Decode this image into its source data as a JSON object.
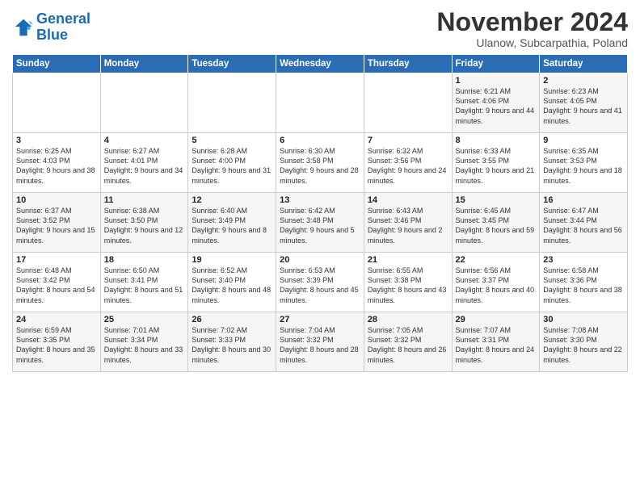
{
  "header": {
    "logo_line1": "General",
    "logo_line2": "Blue",
    "month": "November 2024",
    "location": "Ulanow, Subcarpathia, Poland"
  },
  "days_of_week": [
    "Sunday",
    "Monday",
    "Tuesday",
    "Wednesday",
    "Thursday",
    "Friday",
    "Saturday"
  ],
  "weeks": [
    [
      {
        "day": "",
        "info": ""
      },
      {
        "day": "",
        "info": ""
      },
      {
        "day": "",
        "info": ""
      },
      {
        "day": "",
        "info": ""
      },
      {
        "day": "",
        "info": ""
      },
      {
        "day": "1",
        "info": "Sunrise: 6:21 AM\nSunset: 4:06 PM\nDaylight: 9 hours and 44 minutes."
      },
      {
        "day": "2",
        "info": "Sunrise: 6:23 AM\nSunset: 4:05 PM\nDaylight: 9 hours and 41 minutes."
      }
    ],
    [
      {
        "day": "3",
        "info": "Sunrise: 6:25 AM\nSunset: 4:03 PM\nDaylight: 9 hours and 38 minutes."
      },
      {
        "day": "4",
        "info": "Sunrise: 6:27 AM\nSunset: 4:01 PM\nDaylight: 9 hours and 34 minutes."
      },
      {
        "day": "5",
        "info": "Sunrise: 6:28 AM\nSunset: 4:00 PM\nDaylight: 9 hours and 31 minutes."
      },
      {
        "day": "6",
        "info": "Sunrise: 6:30 AM\nSunset: 3:58 PM\nDaylight: 9 hours and 28 minutes."
      },
      {
        "day": "7",
        "info": "Sunrise: 6:32 AM\nSunset: 3:56 PM\nDaylight: 9 hours and 24 minutes."
      },
      {
        "day": "8",
        "info": "Sunrise: 6:33 AM\nSunset: 3:55 PM\nDaylight: 9 hours and 21 minutes."
      },
      {
        "day": "9",
        "info": "Sunrise: 6:35 AM\nSunset: 3:53 PM\nDaylight: 9 hours and 18 minutes."
      }
    ],
    [
      {
        "day": "10",
        "info": "Sunrise: 6:37 AM\nSunset: 3:52 PM\nDaylight: 9 hours and 15 minutes."
      },
      {
        "day": "11",
        "info": "Sunrise: 6:38 AM\nSunset: 3:50 PM\nDaylight: 9 hours and 12 minutes."
      },
      {
        "day": "12",
        "info": "Sunrise: 6:40 AM\nSunset: 3:49 PM\nDaylight: 9 hours and 8 minutes."
      },
      {
        "day": "13",
        "info": "Sunrise: 6:42 AM\nSunset: 3:48 PM\nDaylight: 9 hours and 5 minutes."
      },
      {
        "day": "14",
        "info": "Sunrise: 6:43 AM\nSunset: 3:46 PM\nDaylight: 9 hours and 2 minutes."
      },
      {
        "day": "15",
        "info": "Sunrise: 6:45 AM\nSunset: 3:45 PM\nDaylight: 8 hours and 59 minutes."
      },
      {
        "day": "16",
        "info": "Sunrise: 6:47 AM\nSunset: 3:44 PM\nDaylight: 8 hours and 56 minutes."
      }
    ],
    [
      {
        "day": "17",
        "info": "Sunrise: 6:48 AM\nSunset: 3:42 PM\nDaylight: 8 hours and 54 minutes."
      },
      {
        "day": "18",
        "info": "Sunrise: 6:50 AM\nSunset: 3:41 PM\nDaylight: 8 hours and 51 minutes."
      },
      {
        "day": "19",
        "info": "Sunrise: 6:52 AM\nSunset: 3:40 PM\nDaylight: 8 hours and 48 minutes."
      },
      {
        "day": "20",
        "info": "Sunrise: 6:53 AM\nSunset: 3:39 PM\nDaylight: 8 hours and 45 minutes."
      },
      {
        "day": "21",
        "info": "Sunrise: 6:55 AM\nSunset: 3:38 PM\nDaylight: 8 hours and 43 minutes."
      },
      {
        "day": "22",
        "info": "Sunrise: 6:56 AM\nSunset: 3:37 PM\nDaylight: 8 hours and 40 minutes."
      },
      {
        "day": "23",
        "info": "Sunrise: 6:58 AM\nSunset: 3:36 PM\nDaylight: 8 hours and 38 minutes."
      }
    ],
    [
      {
        "day": "24",
        "info": "Sunrise: 6:59 AM\nSunset: 3:35 PM\nDaylight: 8 hours and 35 minutes."
      },
      {
        "day": "25",
        "info": "Sunrise: 7:01 AM\nSunset: 3:34 PM\nDaylight: 8 hours and 33 minutes."
      },
      {
        "day": "26",
        "info": "Sunrise: 7:02 AM\nSunset: 3:33 PM\nDaylight: 8 hours and 30 minutes."
      },
      {
        "day": "27",
        "info": "Sunrise: 7:04 AM\nSunset: 3:32 PM\nDaylight: 8 hours and 28 minutes."
      },
      {
        "day": "28",
        "info": "Sunrise: 7:05 AM\nSunset: 3:32 PM\nDaylight: 8 hours and 26 minutes."
      },
      {
        "day": "29",
        "info": "Sunrise: 7:07 AM\nSunset: 3:31 PM\nDaylight: 8 hours and 24 minutes."
      },
      {
        "day": "30",
        "info": "Sunrise: 7:08 AM\nSunset: 3:30 PM\nDaylight: 8 hours and 22 minutes."
      }
    ]
  ]
}
